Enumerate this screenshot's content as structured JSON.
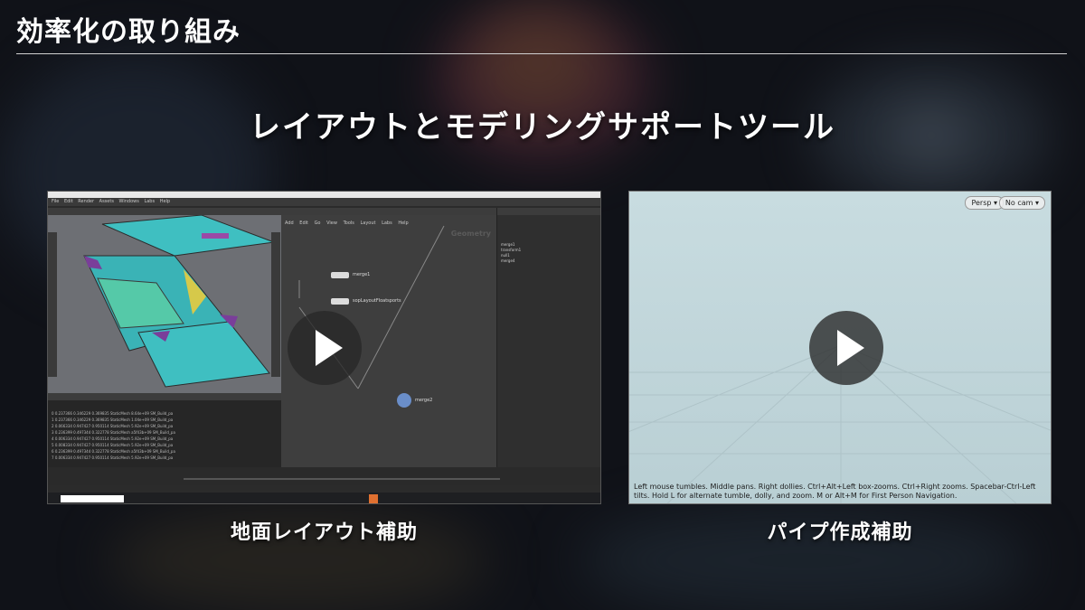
{
  "slide": {
    "heading": "効率化の取り組み",
    "subtitle": "レイアウトとモデリングサポートツール"
  },
  "left_video": {
    "caption": "地面レイアウト補助",
    "menu": [
      "File",
      "Edit",
      "Render",
      "Assets",
      "Windows",
      "Labs",
      "Help"
    ],
    "network_menu": [
      "Add",
      "Edit",
      "Go",
      "View",
      "Tools",
      "Layout",
      "Labs",
      "Help"
    ],
    "network_label": "Geometry",
    "nodes": [
      "merge1",
      "sopLayoutFloatsports",
      "merge2"
    ],
    "param_rows": [
      "merge1",
      "transform1",
      "null1",
      "merge4"
    ],
    "spread_rows": [
      "0   0.237366   0.346229   0.369835   StaticMesh   8.64e+09   SM_Build_pa",
      "1   0.237366   0.346229   0.369835   StaticMesh   1.04e+09   SM_Build_pa",
      "2   0.066334   0.947427   0.950114   StaticMesh   5.92e+09   SM_Build_pa",
      "3   0.236399   0.497344   0.322778   StaticMesh   a5f43b+09  SM_Build_pa",
      "4   0.006334   0.947427   0.950114   StaticMesh   5.92e+09   SM_Build_pa",
      "5   0.008334   0.947427   0.950114   StaticMesh   5.92e+09   SM_Build_pa",
      "6   0.236399   0.497344   0.322778   StaticMesh   a5f43b+09  SM_Build_pa",
      "7   0.006334   0.947427   0.950114   StaticMesh   5.92e+09   SM_Build_pa"
    ]
  },
  "right_video": {
    "caption": "パイプ作成補助",
    "persp_button": "Persp ▾",
    "cam_button": "No cam ▾",
    "hint": "Left mouse tumbles. Middle pans. Right dollies. Ctrl+Alt+Left box-zooms. Ctrl+Right zooms. Spacebar-Ctrl-Left tilts. Hold L for alternate tumble, dolly, and zoom.    M or Alt+M for First Person Navigation."
  },
  "colors": {
    "heading_line": "#d0d0d0",
    "viewport_floor": "#c8dce0",
    "floor_cyan": "#3fbfc1"
  }
}
